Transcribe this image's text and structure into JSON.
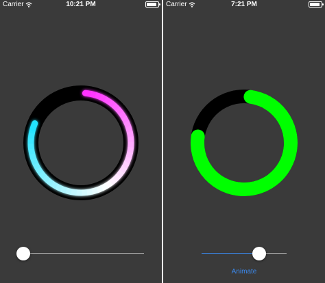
{
  "left_screen": {
    "status_bar": {
      "carrier": "Carrier",
      "time": "10:21 PM"
    },
    "ring": {
      "progress": 0.8,
      "colors": {
        "start": "#22e3ff",
        "mid": "#ffffff",
        "end": "#ff30ff",
        "background": "#000000"
      }
    },
    "slider": {
      "value": 0.0,
      "track_color": "#b5b5b5",
      "filled_color": "#3a8af0"
    }
  },
  "right_screen": {
    "status_bar": {
      "carrier": "Carrier",
      "time": "7:21 PM"
    },
    "ring": {
      "progress": 0.75,
      "colors": {
        "fill": "#00ff00",
        "background": "#000000"
      }
    },
    "slider": {
      "value": 0.71,
      "track_color": "#b5b5b5",
      "filled_color": "#3a8af0"
    },
    "button": {
      "label": "Animate",
      "color": "#3a8af0"
    }
  },
  "icons": {
    "wifi": "wifi-icon",
    "battery": "battery-icon"
  }
}
